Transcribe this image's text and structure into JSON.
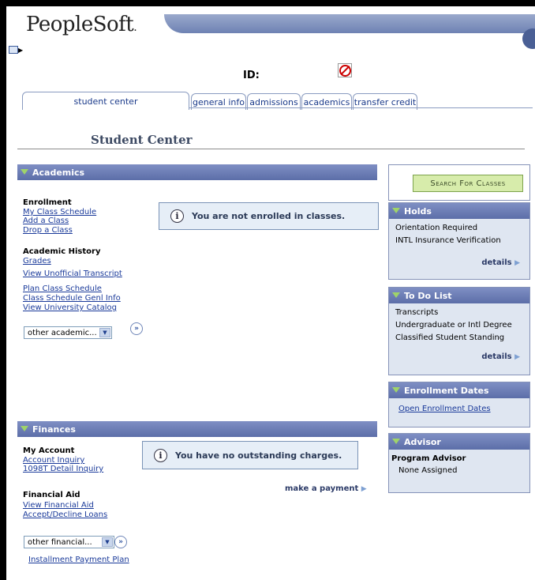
{
  "brand": {
    "logo_text": "PeopleSoft",
    "logo_mark": "."
  },
  "header": {
    "id_label": "ID:"
  },
  "tabs": [
    {
      "label": "student center",
      "active": true
    },
    {
      "label": "general info"
    },
    {
      "label": "admissions"
    },
    {
      "label": "academics"
    },
    {
      "label": "transfer credit"
    }
  ],
  "page_title": "Student Center",
  "academics": {
    "section_title": "Academics",
    "enrollment_label": "Enrollment",
    "enrollment_links": [
      "My Class Schedule",
      "Add a Class",
      "Drop a Class"
    ],
    "history_label": "Academic History",
    "history_links": [
      "Grades",
      "View Unofficial Transcript"
    ],
    "plan_links": [
      "Plan Class Schedule",
      "Class Schedule Genl Info",
      "View University Catalog"
    ],
    "dropdown_value": "other academic...",
    "message": "You are not enrolled in classes."
  },
  "finances": {
    "section_title": "Finances",
    "account_label": "My Account",
    "account_links": [
      "Account Inquiry",
      "1098T Detail Inquiry"
    ],
    "aid_label": "Financial Aid",
    "aid_links": [
      "View Financial Aid",
      "Accept/Decline Loans"
    ],
    "message": "You have no outstanding charges.",
    "make_payment": "make a payment",
    "dropdown_value": "other financial...",
    "installment_link": "Installment Payment Plan"
  },
  "search_button": "Search For Classes",
  "holds": {
    "title": "Holds",
    "items": [
      "Orientation Required",
      "INTL Insurance Verification"
    ],
    "details": "details"
  },
  "todo": {
    "title": "To Do List",
    "items": [
      "Transcripts",
      "Undergraduate or Intl Degree",
      "Classified Student Standing"
    ],
    "details": "details"
  },
  "enrollment_dates": {
    "title": "Enrollment Dates",
    "link": "Open Enrollment Dates"
  },
  "advisor": {
    "title": "Advisor",
    "label": "Program Advisor",
    "value": "None Assigned"
  },
  "colors": {
    "section_bar": "#6f80b8",
    "panel_bg": "#dfe6f1",
    "link": "#1a3a9a",
    "search_btn": "#d7ecab"
  }
}
